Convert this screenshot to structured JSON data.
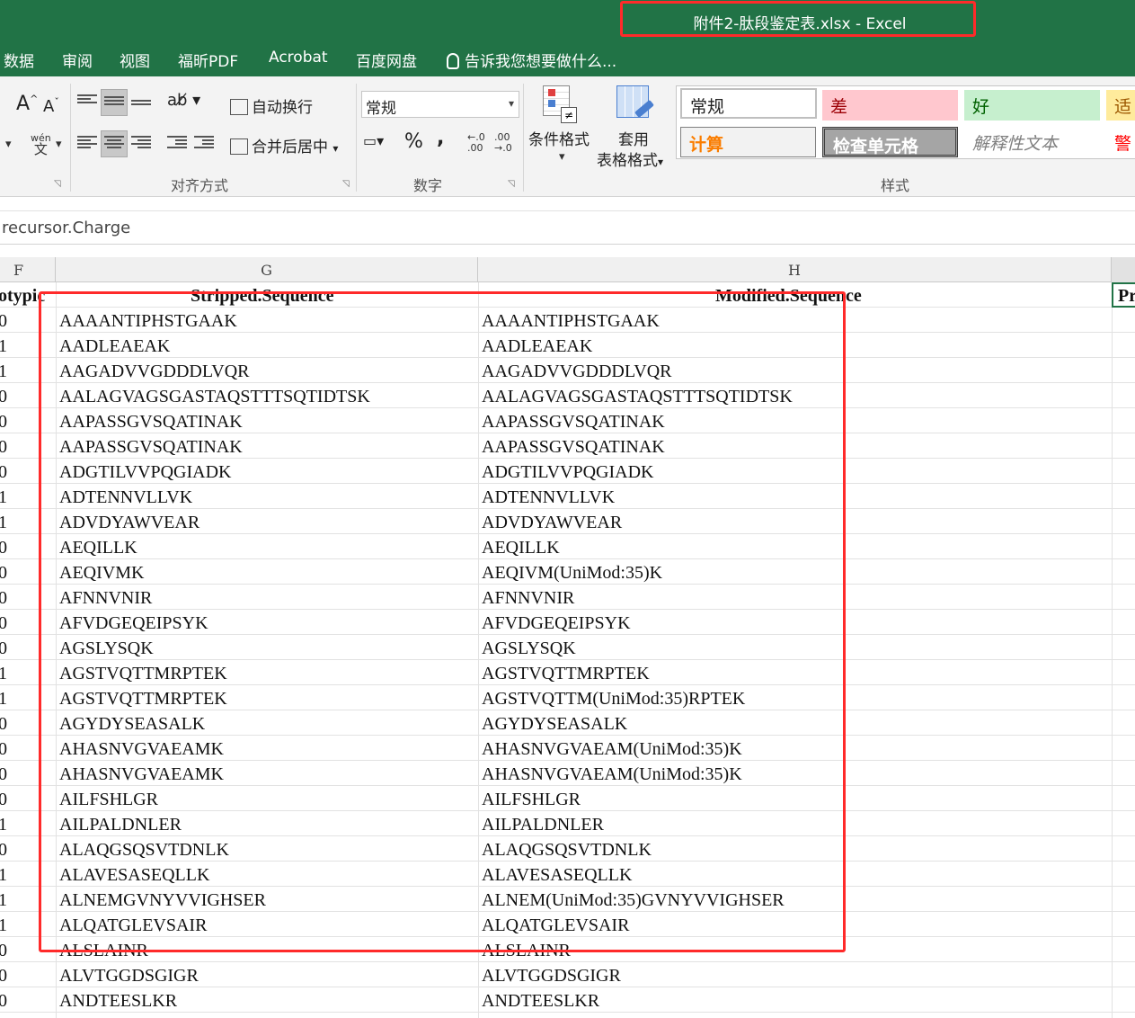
{
  "window": {
    "title": "附件2-肽段鉴定表.xlsx - Excel"
  },
  "menu": {
    "items": [
      "数据",
      "审阅",
      "视图",
      "福昕PDF",
      "Acrobat",
      "百度网盘"
    ],
    "tell_me": "告诉我您想要做什么..."
  },
  "ribbon": {
    "alignment": {
      "wrap_text": "自动换行",
      "merge_center": "合并后居中",
      "label": "对齐方式",
      "wen_glyph_top": "wén",
      "wen_glyph_bottom": "文"
    },
    "number": {
      "format_value": "常规",
      "percent": "%",
      "comma": ",",
      "dec_inc": ".0\n.00",
      "dec_dec": ".00\n→.0",
      "label": "数字"
    },
    "styles": {
      "conditional_format": "条件格式",
      "table_format_line1": "套用",
      "table_format_line2": "表格格式",
      "label": "样式",
      "cells": [
        "常规",
        "差",
        "好",
        "适",
        "计算",
        "检查单元格",
        "解释性文本",
        "警"
      ]
    }
  },
  "formula_bar": {
    "content": "recursor.Charge"
  },
  "columns": {
    "f": "F",
    "g": "G",
    "h": "H"
  },
  "sheet": {
    "header": {
      "f": "otypic",
      "g": "Stripped.Sequence",
      "h": "Modified.Sequence",
      "i": "Pr"
    },
    "rows": [
      {
        "f": "0",
        "g": "AAAANTIPHSTGAAK",
        "h": "AAAANTIPHSTGAAK"
      },
      {
        "f": "1",
        "g": "AADLEAEAK",
        "h": "AADLEAEAK"
      },
      {
        "f": "1",
        "g": "AAGADVVGDDDLVQR",
        "h": "AAGADVVGDDDLVQR"
      },
      {
        "f": "0",
        "g": "AALAGVAGSGASTAQSTTTSQTIDTSK",
        "h": "AALAGVAGSGASTAQSTTTSQTIDTSK"
      },
      {
        "f": "0",
        "g": "AAPASSGVSQATINAK",
        "h": "AAPASSGVSQATINAK"
      },
      {
        "f": "0",
        "g": "AAPASSGVSQATINAK",
        "h": "AAPASSGVSQATINAK"
      },
      {
        "f": "0",
        "g": "ADGTILVVPQGIADK",
        "h": "ADGTILVVPQGIADK"
      },
      {
        "f": "1",
        "g": "ADTENNVLLVK",
        "h": "ADTENNVLLVK"
      },
      {
        "f": "1",
        "g": "ADVDYAWVEAR",
        "h": "ADVDYAWVEAR"
      },
      {
        "f": "0",
        "g": "AEQILLK",
        "h": "AEQILLK"
      },
      {
        "f": "0",
        "g": "AEQIVMK",
        "h": "AEQIVM(UniMod:35)K"
      },
      {
        "f": "0",
        "g": "AFNNVNIR",
        "h": "AFNNVNIR"
      },
      {
        "f": "0",
        "g": "AFVDGEQEIPSYK",
        "h": "AFVDGEQEIPSYK"
      },
      {
        "f": "0",
        "g": "AGSLYSQK",
        "h": "AGSLYSQK"
      },
      {
        "f": "1",
        "g": "AGSTVQTTMRPTEK",
        "h": "AGSTVQTTMRPTEK"
      },
      {
        "f": "1",
        "g": "AGSTVQTTMRPTEK",
        "h": "AGSTVQTTM(UniMod:35)RPTEK"
      },
      {
        "f": "0",
        "g": "AGYDYSEASALK",
        "h": "AGYDYSEASALK"
      },
      {
        "f": "0",
        "g": "AHASNVGVAEAMK",
        "h": "AHASNVGVAEAM(UniMod:35)K"
      },
      {
        "f": "0",
        "g": "AHASNVGVAEAMK",
        "h": "AHASNVGVAEAM(UniMod:35)K"
      },
      {
        "f": "0",
        "g": "AILFSHLGR",
        "h": "AILFSHLGR"
      },
      {
        "f": "1",
        "g": "AILPALDNLER",
        "h": "AILPALDNLER"
      },
      {
        "f": "0",
        "g": "ALAQGSQSVTDNLK",
        "h": "ALAQGSQSVTDNLK"
      },
      {
        "f": "1",
        "g": "ALAVESASEQLLK",
        "h": "ALAVESASEQLLK"
      },
      {
        "f": "1",
        "g": "ALNEMGVNYVVIGHSER",
        "h": "ALNEM(UniMod:35)GVNYVVIGHSER"
      },
      {
        "f": "1",
        "g": "ALQATGLEVSAIR",
        "h": "ALQATGLEVSAIR"
      },
      {
        "f": "0",
        "g": "ALSLAINR",
        "h": "ALSLAINR"
      },
      {
        "f": "0",
        "g": "ALVTGGDSGIGR",
        "h": "ALVTGGDSGIGR"
      },
      {
        "f": "0",
        "g": "ANDTEESLKR",
        "h": "ANDTEESLKR"
      }
    ]
  },
  "colors": {
    "excel_green": "#217346",
    "annotation_red": "#ff2a2a"
  }
}
